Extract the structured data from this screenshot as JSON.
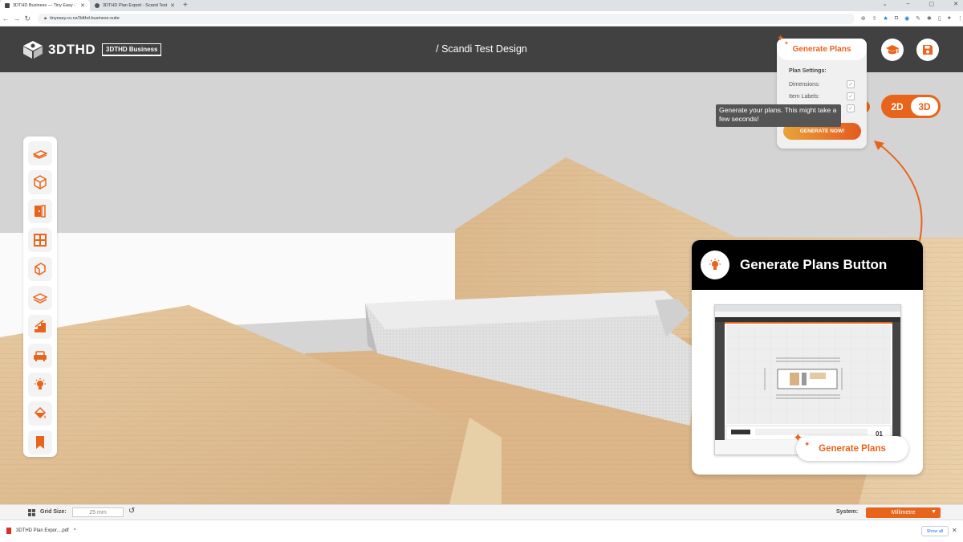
{
  "browser": {
    "tabs": [
      {
        "title": "3DTHD Business — Tiny Easy - Ti",
        "active": true
      },
      {
        "title": "3DTHD Plan Export - Scand Test",
        "active": false
      }
    ],
    "url": "tinyeasy.co.nz/3dthd-business-suite",
    "new_tab": "+",
    "window_controls": [
      "⌄",
      "–",
      "▢",
      "✕"
    ]
  },
  "header": {
    "logo_text": "3DTHD",
    "business_badge": "3DTHD Business",
    "project_title": "/ Scandi Test Design"
  },
  "generate_panel": {
    "button_label": "Generate Plans",
    "settings_title": "Plan Settings:",
    "dimensions_label": "Dimensions:",
    "item_labels_label": "Item Labels:",
    "generate_now_label": "GENERATE NOW!",
    "tooltip": "Generate your plans. This might take a few seconds!"
  },
  "view_toggle": {
    "option_2d": "2D",
    "option_3d": "3D",
    "selected": "3D"
  },
  "callout": {
    "title": "Generate Plans Button",
    "pill_label": "Generate Plans",
    "preview_page_number": "01"
  },
  "bottom_bar": {
    "grid_size_label": "Grid Size:",
    "grid_size_value": "25 mm",
    "system_label": "System:",
    "system_value": "Millimetre"
  },
  "download_bar": {
    "file_name": "3DTHD Plan Expor....pdf",
    "show_all": "Show all",
    "close": "✕"
  },
  "colors": {
    "accent": "#e8641b",
    "header_bg": "#414141",
    "scene_bg": "#d5d5d5"
  }
}
